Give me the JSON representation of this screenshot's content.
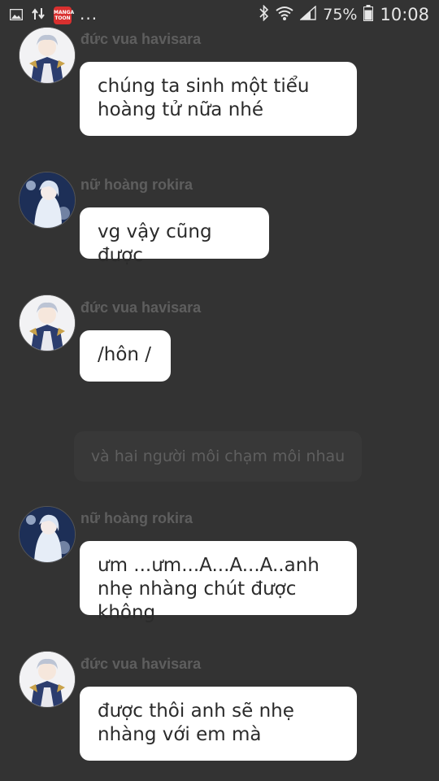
{
  "status_bar": {
    "manga_app_label": "MANGA TOON",
    "overflow": "...",
    "battery_percent": "75%",
    "time": "10:08",
    "icons": [
      "image-icon",
      "transfer-arrows-icon",
      "manga-toon-app-icon",
      "bluetooth-icon",
      "wifi-icon",
      "signal-icon",
      "battery-icon"
    ]
  },
  "messages": [
    {
      "sender": "đức vua havisara",
      "text": "chúng ta sinh một tiểu hoàng tử nữa nhé",
      "avatar": "king"
    },
    {
      "sender": "nữ hoàng rokira",
      "text": "vg vậy cũng được",
      "avatar": "queen"
    },
    {
      "sender": "đức vua havisara",
      "text": "/hôn /",
      "avatar": "king"
    },
    {
      "sender": "nữ hoàng rokira",
      "text": "ưm ...ưm...A...A...A..anh nhẹ nhàng chút được không",
      "avatar": "queen"
    },
    {
      "sender": "đức vua havisara",
      "text": "được thôi anh sẽ nhẹ nhàng với em mà",
      "avatar": "king"
    }
  ],
  "narration": "và hai người môi chạm môi nhau",
  "colors": {
    "background": "#333333",
    "bubble": "#ffffff",
    "sender_text": "#5e5e5e",
    "narration_bg": "#383838",
    "status_text": "#e6e6e6"
  }
}
